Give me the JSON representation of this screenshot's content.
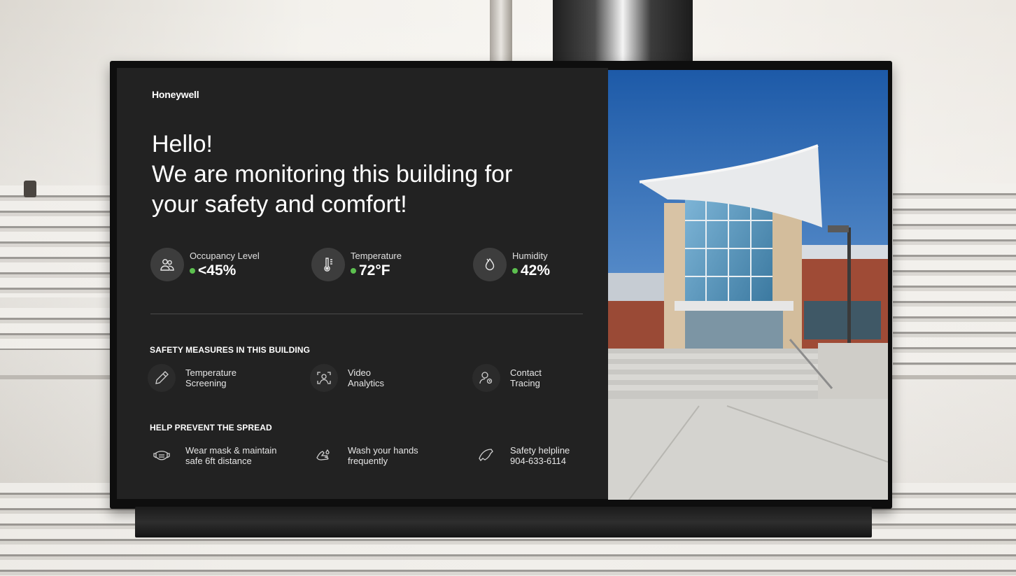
{
  "brand": {
    "logo_text": "Honeywell"
  },
  "headline": {
    "line1": "Hello!",
    "line2": "We are monitoring this building for",
    "line3": "your safety and comfort!"
  },
  "metrics": [
    {
      "label": "Occupancy Level",
      "value": "<45%",
      "icon": "people-icon",
      "status_color": "#5cc04f"
    },
    {
      "label": "Temperature",
      "value": "72°F",
      "icon": "thermometer-icon",
      "status_color": "#5cc04f"
    },
    {
      "label": "Humidity",
      "value": "42%",
      "icon": "droplets-icon",
      "status_color": "#5cc04f"
    }
  ],
  "safety_measures": {
    "title": "SAFETY MEASURES IN THIS BUILDING",
    "items": [
      {
        "text": "Temperature\nScreening",
        "icon": "thermometer-gun-icon"
      },
      {
        "text": "Video\nAnalytics",
        "icon": "face-scan-icon"
      },
      {
        "text": "Contact\nTracing",
        "icon": "user-search-icon"
      }
    ]
  },
  "help_prevent": {
    "title": "HELP PREVENT THE SPREAD",
    "items": [
      {
        "text": "Wear mask & maintain\nsafe 6ft distance",
        "icon": "mask-icon"
      },
      {
        "text": "Wash your hands\nfrequently",
        "icon": "hand-wash-icon"
      },
      {
        "text": "Safety helpline\n904-633-6114",
        "icon": "phone-icon"
      }
    ]
  }
}
